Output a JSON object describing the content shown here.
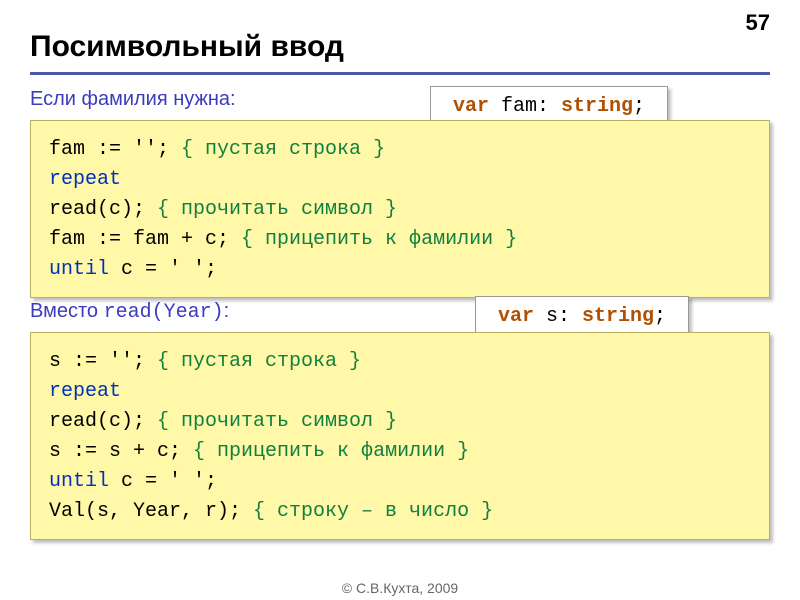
{
  "page_number": "57",
  "slide_title": "Посимвольный ввод",
  "sub1": "Если фамилия нужна:",
  "sub2_prefix": "Вместо ",
  "sub2_mono": "read(Year)",
  "sub2_suffix": ":",
  "varbox1": {
    "kw": "var",
    "mid": " fam: ",
    "type": "string",
    "tail": ";"
  },
  "varbox2": {
    "kw": "var",
    "mid": " s: ",
    "type": "string",
    "tail": ";"
  },
  "code1": {
    "l1a": "fam := '';",
    "l1c": "  { пустая строка }",
    "l2": "repeat",
    "l3a": "  read(c);",
    "l3c": "        { прочитать символ }",
    "l4a": "  fam := fam + c;",
    "l4c": "  { прицепить к фамилии }",
    "l5a": "until",
    "l5b": " c = ' ';"
  },
  "code2": {
    "l1a": "s := '';",
    "l1c": "  { пустая строка }",
    "l2": "repeat",
    "l3a": "  read(c);",
    "l3c": "        { прочитать символ }",
    "l4a": "  s := s + c;",
    "l4c": "    { прицепить к фамилии }",
    "l5a": "until",
    "l5b": " c = ' ';",
    "l6a": "Val(s, Year, r);",
    "l6c": " { строку – в число }"
  },
  "footer": "© С.В.Кухта, 2009"
}
